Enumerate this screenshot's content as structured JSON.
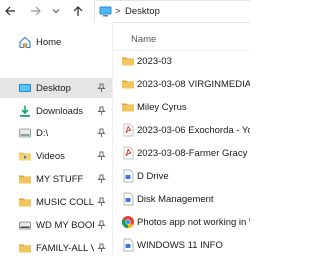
{
  "toolbar": {
    "back_icon": "arrow-left-icon",
    "forward_icon": "arrow-right-icon",
    "recent_icon": "chevron-down-icon",
    "up_icon": "arrow-up-icon"
  },
  "address_bar": {
    "location_icon": "desktop-pc-icon",
    "separator": ">",
    "path": "Desktop"
  },
  "sidebar": {
    "items": [
      {
        "label": "Home",
        "icon": "home-icon"
      },
      {
        "label": "Desktop",
        "icon": "desktop-folder-icon",
        "pinned": true,
        "selected": true
      },
      {
        "label": "Downloads",
        "icon": "downloads-folder-icon",
        "pinned": true
      },
      {
        "label": "D:\\",
        "icon": "drive-icon",
        "pinned": true
      },
      {
        "label": "Videos",
        "icon": "videos-folder-icon",
        "pinned": true
      },
      {
        "label": "MY STUFF",
        "icon": "folder-icon",
        "pinned": true
      },
      {
        "label": "MUSIC COLLECTION",
        "icon": "folder-icon",
        "pinned": true
      },
      {
        "label": "WD MY BOOK (F:)",
        "icon": "drive-icon",
        "pinned": true
      },
      {
        "label": "FAMILY-ALL VIDEOS",
        "icon": "folder-icon",
        "pinned": true
      }
    ]
  },
  "main": {
    "column_header": "Name",
    "files": [
      {
        "name": "2023-03",
        "icon": "folder-icon"
      },
      {
        "name": "2023-03-08  VIRGINMEDIA CO",
        "icon": "folder-icon"
      },
      {
        "name": "Miley Cyrus",
        "icon": "folder-icon"
      },
      {
        "name": "2023-03-06 Exochorda - Your D",
        "icon": "pdf-icon"
      },
      {
        "name": "2023-03-08-Farmer Gracy orde",
        "icon": "pdf-icon"
      },
      {
        "name": "D Drive",
        "icon": "shortcut-icon"
      },
      {
        "name": "Disk Management",
        "icon": "shortcut-icon"
      },
      {
        "name": "Photos app not working in Wi",
        "icon": "chrome-icon"
      },
      {
        "name": "WINDOWS 11 INFO",
        "icon": "shortcut-icon"
      }
    ]
  },
  "colors": {
    "folder": "#f2c55c",
    "folder_dark": "#d9a73a",
    "pdf": "#d93025",
    "selected_bg": "#e5e5e5",
    "accent": "#0078d4"
  }
}
